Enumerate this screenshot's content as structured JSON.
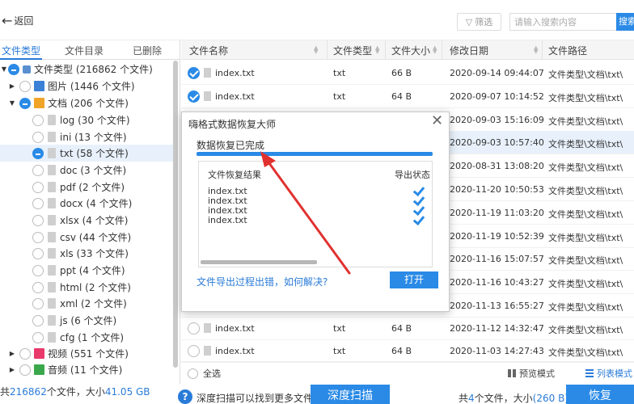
{
  "topbar": {
    "back_label": "返回",
    "filter_label": "筛选",
    "search_placeholder": "请输入搜索内容",
    "search_button": "搜索"
  },
  "left_tabs": [
    {
      "label": "文件类型",
      "active": true
    },
    {
      "label": "文件目录",
      "active": false
    },
    {
      "label": "已删除",
      "active": false
    }
  ],
  "tree": [
    {
      "label": "文件类型 (216862 个文件)"
    },
    {
      "label": "图片 (1446 个文件)"
    },
    {
      "label": "文档 (206 个文件)"
    },
    {
      "label": "log (30 个文件)"
    },
    {
      "label": "ini (13 个文件)"
    },
    {
      "label": "txt (58 个文件)"
    },
    {
      "label": "doc (3 个文件)"
    },
    {
      "label": "pdf (2 个文件)"
    },
    {
      "label": "docx (4 个文件)"
    },
    {
      "label": "xlsx (4 个文件)"
    },
    {
      "label": "csv (44 个文件)"
    },
    {
      "label": "xls (33 个文件)"
    },
    {
      "label": "ppt (4 个文件)"
    },
    {
      "label": "html (2 个文件)"
    },
    {
      "label": "xml (2 个文件)"
    },
    {
      "label": "js (6 个文件)"
    },
    {
      "label": "cfg (1 个文件)"
    },
    {
      "label": "视频 (551 个文件)"
    },
    {
      "label": "音频 (11 个文件)"
    }
  ],
  "left_status": {
    "prefix": "共",
    "count": "216862",
    "mid": "个文件，大小",
    "size": "41.05 GB"
  },
  "table": {
    "headers": [
      "文件名称",
      "文件类型",
      "文件大小",
      "修改日期",
      "文件路径"
    ],
    "rows": [
      {
        "name": "index.txt",
        "type": "txt",
        "size": "66 B",
        "date": "2020-09-14 09:44:07",
        "path": "文件类型\\文档\\txt\\"
      },
      {
        "name": "index.txt",
        "type": "txt",
        "size": "64 B",
        "date": "2020-09-07 10:14:52",
        "path": "文件类型\\文档\\txt\\"
      },
      {
        "name": "",
        "type": "",
        "size": "",
        "date": "2020-09-03 15:16:09",
        "path": "文件类型\\文档\\txt\\"
      },
      {
        "name": "",
        "type": "",
        "size": "",
        "date": "2020-09-03 10:57:40",
        "path": "文件类型\\文档\\txt\\"
      },
      {
        "name": "",
        "type": "",
        "size": "",
        "date": "2020-08-31 13:08:20",
        "path": "文件类型\\文档\\txt\\"
      },
      {
        "name": "",
        "type": "",
        "size": "",
        "date": "2020-11-20 10:50:53",
        "path": "文件类型\\文档\\txt\\"
      },
      {
        "name": "",
        "type": "",
        "size": "",
        "date": "2020-11-19 11:03:20",
        "path": "文件类型\\文档\\txt\\"
      },
      {
        "name": "",
        "type": "",
        "size": "",
        "date": "2020-11-19 10:52:39",
        "path": "文件类型\\文档\\txt\\"
      },
      {
        "name": "",
        "type": "",
        "size": "",
        "date": "2020-11-16 15:07:57",
        "path": "文件类型\\文档\\txt\\"
      },
      {
        "name": "",
        "type": "",
        "size": "",
        "date": "2020-11-16 10:43:27",
        "path": "文件类型\\文档\\txt\\"
      },
      {
        "name": "",
        "type": "",
        "size": "",
        "date": "2020-11-13 16:55:27",
        "path": "文件类型\\文档\\txt\\"
      },
      {
        "name": "index.txt",
        "type": "txt",
        "size": "64 B",
        "date": "2020-11-12 14:32:47",
        "path": "文件类型\\文档\\txt\\"
      },
      {
        "name": "index.txt",
        "type": "txt",
        "size": "64 B",
        "date": "2020-11-03 14:27:43",
        "path": "文件类型\\文档\\txt\\"
      }
    ],
    "select_all": "全选",
    "preview_mode": "预览模式",
    "list_mode": "列表模式"
  },
  "bottom": {
    "help_icon": "?",
    "help_text": "深度扫描可以找到更多文件",
    "deep_scan": "深度扫描",
    "sel_prefix": "共",
    "sel_count": "4",
    "sel_mid": "个文件，大小",
    "sel_size": "(260 B)",
    "recover": "恢复"
  },
  "dialog": {
    "title": "嗨格式数据恢复大师",
    "close": "✕",
    "status": "数据恢复已完成",
    "progress": 1.0,
    "col_result": "文件恢复结果",
    "col_export": "导出状态",
    "items": [
      "index.txt",
      "index.txt",
      "index.txt",
      "index.txt"
    ],
    "link": "文件导出过程出错，如何解决?",
    "open": "打开"
  },
  "colors": {
    "accent": "#2a8ae6",
    "annotation": "#e0312e"
  }
}
